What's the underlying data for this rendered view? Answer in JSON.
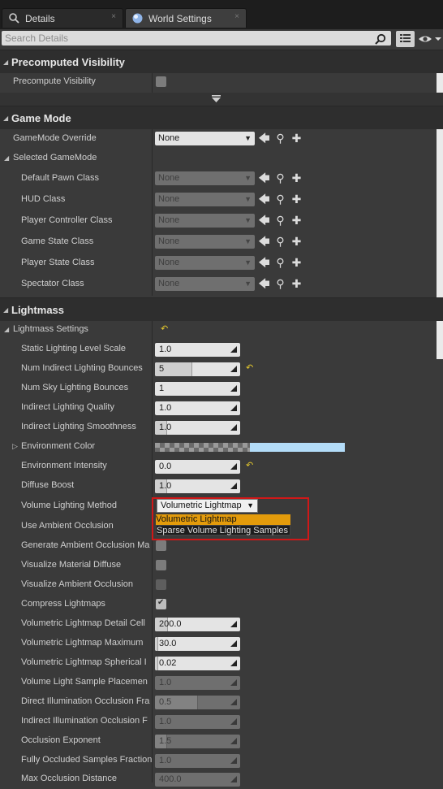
{
  "tabs": [
    {
      "label": "Details",
      "close": "×"
    },
    {
      "label": "World Settings",
      "close": "×"
    }
  ],
  "search": {
    "placeholder": "Search Details"
  },
  "categories": {
    "precomputed_visibility": "Precomputed Visibility",
    "game_mode": "Game Mode",
    "lightmass": "Lightmass"
  },
  "precompute": {
    "label": "Precompute Visibility",
    "checked": false
  },
  "gamemode": {
    "override_label": "GameMode Override",
    "override_value": "None",
    "selected_label": "Selected GameMode",
    "classes": [
      {
        "label": "Default Pawn Class",
        "value": "None"
      },
      {
        "label": "HUD Class",
        "value": "None"
      },
      {
        "label": "Player Controller Class",
        "value": "None"
      },
      {
        "label": "Game State Class",
        "value": "None"
      },
      {
        "label": "Player State Class",
        "value": "None"
      },
      {
        "label": "Spectator Class",
        "value": "None"
      }
    ]
  },
  "lightmass": {
    "settings_label": "Lightmass Settings",
    "static_scale": {
      "label": "Static Lighting Level Scale",
      "value": "1.0"
    },
    "indirect_bounces": {
      "label": "Num Indirect Lighting Bounces",
      "value": "5"
    },
    "sky_bounces": {
      "label": "Num Sky Lighting Bounces",
      "value": "1"
    },
    "indirect_quality": {
      "label": "Indirect Lighting Quality",
      "value": "1.0"
    },
    "indirect_smoothness": {
      "label": "Indirect Lighting Smoothness",
      "value": "1.0"
    },
    "env_color": {
      "label": "Environment Color",
      "color": "#b3dcf8"
    },
    "env_intensity": {
      "label": "Environment Intensity",
      "value": "0.0"
    },
    "diffuse_boost": {
      "label": "Diffuse Boost",
      "value": "1.0"
    },
    "volume_method": {
      "label": "Volume Lighting Method",
      "value": "Volumetric Lightmap",
      "options": [
        "Volumetric Lightmap",
        "Sparse Volume Lighting Samples"
      ]
    },
    "use_ao": {
      "label": "Use Ambient Occlusion"
    },
    "gen_ao": {
      "label": "Generate Ambient Occlusion Ma"
    },
    "vis_diffuse": {
      "label": "Visualize Material Diffuse"
    },
    "vis_ao": {
      "label": "Visualize Ambient Occlusion"
    },
    "compress": {
      "label": "Compress Lightmaps",
      "checked": true
    },
    "vlm_detail": {
      "label": "Volumetric Lightmap Detail Cell",
      "value": "200.0"
    },
    "vlm_max": {
      "label": "Volumetric Lightmap Maximum",
      "value": "30.0"
    },
    "vlm_spherical": {
      "label": "Volumetric Lightmap Spherical I",
      "value": "0.02"
    },
    "vls_placement": {
      "label": "Volume Light Sample Placemen",
      "value": "1.0"
    },
    "direct_occ": {
      "label": "Direct Illumination Occlusion Fra",
      "value": "0.5"
    },
    "indirect_occ": {
      "label": "Indirect Illumination Occlusion F",
      "value": "1.0"
    },
    "occ_exponent": {
      "label": "Occlusion Exponent",
      "value": "1.5"
    },
    "fully_occluded": {
      "label": "Fully Occluded Samples Fraction",
      "value": "1.0"
    },
    "max_occ_dist": {
      "label": "Max Occlusion Distance",
      "value": "400.0"
    }
  },
  "colors": {
    "accent_selected": "#e39b0b",
    "highlight_outline": "#d01818",
    "reset_arrow": "#e3c72d"
  }
}
